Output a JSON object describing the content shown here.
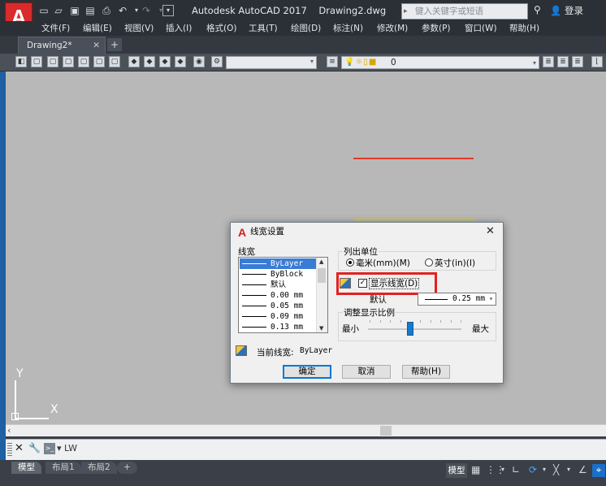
{
  "app": {
    "logo": "A",
    "title": "Autodesk AutoCAD 2017",
    "drawing": "Drawing2.dwg",
    "search_placeholder": "键入关键字或短语",
    "login": "登录"
  },
  "quick_access": [
    "new-icon",
    "open-icon",
    "save-icon",
    "saveas-icon",
    "plot-icon",
    "undo-icon",
    "redo-icon",
    "customize-icon"
  ],
  "menu": [
    "文件(F)",
    "编辑(E)",
    "视图(V)",
    "插入(I)",
    "格式(O)",
    "工具(T)",
    "绘图(D)",
    "标注(N)",
    "修改(M)",
    "参数(P)",
    "窗口(W)",
    "帮助(H)"
  ],
  "tabs": {
    "active": "Drawing2*",
    "add": "+"
  },
  "toolbar": {
    "layer_value": "0"
  },
  "ucs": {
    "y": "Y",
    "x": "X"
  },
  "command": {
    "text": "LW",
    "prompt_icon": ">_"
  },
  "layout_tabs": [
    "模型",
    "布局1",
    "布局2",
    "+"
  ],
  "status": {
    "model": "模型"
  },
  "dialog": {
    "title": "线宽设置",
    "lineweights_label": "线宽",
    "lineweights": [
      "ByLayer",
      "ByBlock",
      "默认",
      "0.00 mm",
      "0.05 mm",
      "0.09 mm",
      "0.13 mm"
    ],
    "selected_index": 0,
    "units_group": "列出单位",
    "unit_mm": "毫米(mm)(M)",
    "unit_in": "英寸(in)(I)",
    "unit_selected": "mm",
    "show_lineweight": "显示线宽(D)",
    "show_lineweight_checked": true,
    "default_label": "默认",
    "default_value": "0.25 mm",
    "scale_group": "调整显示比例",
    "scale_min": "最小",
    "scale_max": "最大",
    "current_label": "当前线宽:",
    "current_value": "ByLayer",
    "ok": "确定",
    "cancel": "取消",
    "help": "帮助(H)"
  },
  "colors": {
    "red_line": "#e03a2a",
    "yellow_line": "#d6cc2a",
    "canvas": "#b8b8b8",
    "highlight_box": "#e42121"
  }
}
